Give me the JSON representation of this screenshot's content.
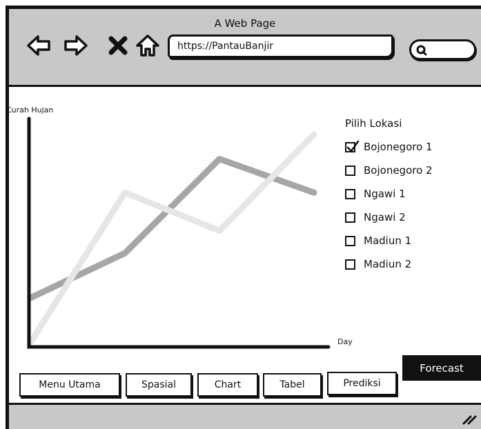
{
  "window": {
    "title": "A Web Page"
  },
  "nav": {
    "url": "https://PantauBanjir",
    "back_icon": "left-arrow-icon",
    "forward_icon": "right-arrow-icon",
    "stop_icon": "close-x-icon",
    "home_icon": "home-icon",
    "search_icon": "search-icon"
  },
  "chart_data": {
    "type": "line",
    "ylabel": "Curah Hujan",
    "xlabel": "Day",
    "x": [
      0,
      1,
      2,
      3
    ],
    "series": [
      {
        "values": [
          0.2,
          0.4,
          0.82,
          0.67
        ],
        "color": "#a6a6a6"
      },
      {
        "values": [
          0.0,
          0.67,
          0.5,
          0.93
        ],
        "color": "#e6e6e6"
      }
    ],
    "ylim": [
      0,
      1
    ],
    "grid": false
  },
  "locations": {
    "title": "Pilih Lokasi",
    "items": [
      {
        "label": "Bojonegoro 1",
        "checked": true
      },
      {
        "label": "Bojonegoro 2",
        "checked": false
      },
      {
        "label": "Ngawi 1",
        "checked": false
      },
      {
        "label": "Ngawi 2",
        "checked": false
      },
      {
        "label": "Madiun 1",
        "checked": false
      },
      {
        "label": "Madiun 2",
        "checked": false
      }
    ]
  },
  "tabs": [
    "Menu Utama",
    "Spasial",
    "Chart",
    "Tabel",
    "Prediksi"
  ],
  "forecast_label": "Forecast"
}
